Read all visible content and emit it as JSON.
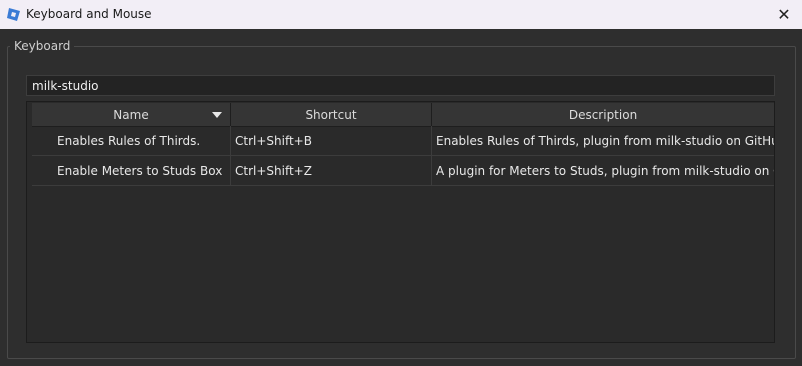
{
  "window": {
    "title": "Keyboard and Mouse"
  },
  "group": {
    "label": "Keyboard"
  },
  "search": {
    "value": "milk-studio"
  },
  "table": {
    "columns": [
      "Name",
      "Shortcut",
      "Description"
    ],
    "rows": [
      {
        "name": "Enables Rules of Thirds.",
        "shortcut": "Ctrl+Shift+B",
        "description": "Enables Rules of Thirds, plugin from milk-studio on GitHub"
      },
      {
        "name": "Enable Meters to Studs Box",
        "shortcut": "Ctrl+Shift+Z",
        "description": "A plugin for Meters to Studs, plugin from milk-studio on GitHub"
      }
    ]
  },
  "colors": {
    "background": "#2e2e2e",
    "titlebar": "#f2eef6",
    "app_icon": "#3a7bd5"
  },
  "icons": {
    "app": "roblox-studio-icon",
    "close": "close-icon",
    "sort": "sort-descending-icon"
  }
}
